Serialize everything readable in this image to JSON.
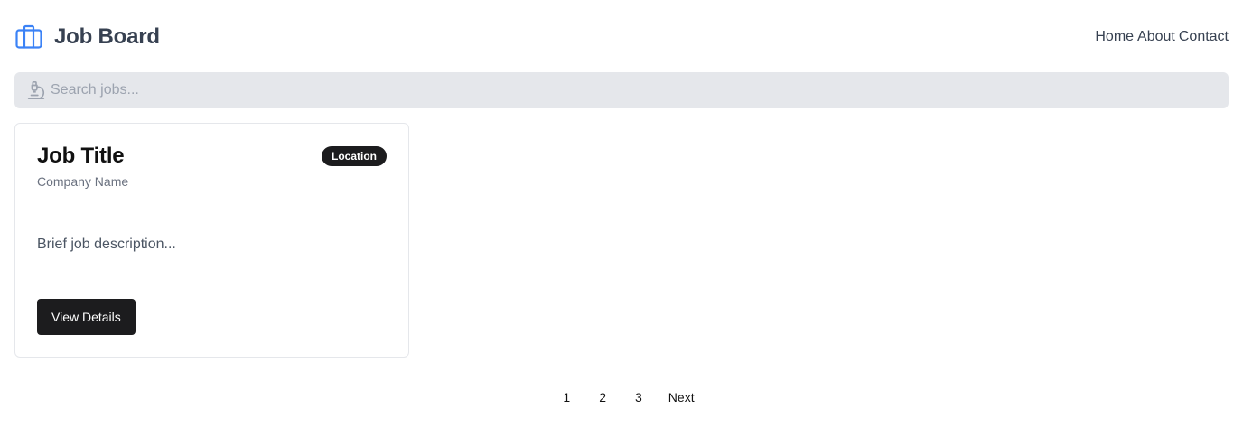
{
  "header": {
    "brand_icon": "briefcase-icon",
    "title": "Job Board",
    "nav": [
      "Home",
      "About",
      "Contact"
    ]
  },
  "search": {
    "icon": "microscope-icon",
    "placeholder": "Search jobs...",
    "value": ""
  },
  "jobs": [
    {
      "title": "Job Title",
      "company": "Company Name",
      "location": "Location",
      "description": "Brief job description...",
      "button_label": "View Details"
    }
  ],
  "pagination": {
    "pages": [
      "1",
      "2",
      "3"
    ],
    "next_label": "Next"
  },
  "colors": {
    "accent": "#3b82f6",
    "dark": "#1c1c1e",
    "search_bg": "#e5e7eb",
    "muted_text": "#6b7280"
  }
}
